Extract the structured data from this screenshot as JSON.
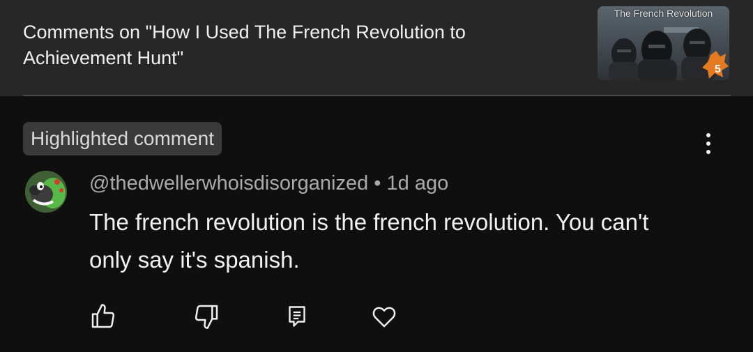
{
  "header": {
    "title": "Comments on \"How I Used The French Revolution to Achievement Hunt\"",
    "thumbnail_text": "The French Revolution",
    "thumbnail_badge": "5"
  },
  "highlight": {
    "badge_label": "Highlighted comment"
  },
  "comment": {
    "author": "@thedwellerwhoisdisorganized",
    "separator": " • ",
    "time": "1d ago",
    "text": "The french revolution is the french revolution. You can't only say it's spanish."
  },
  "actions": [
    "like-icon",
    "dislike-icon",
    "reply-icon",
    "heart-icon"
  ],
  "colors": {
    "background": "#0f0f0f",
    "header_bg": "#272727",
    "badge_bg": "#3a3a3a",
    "text_primary": "#f1f1f1",
    "text_secondary": "#aaaaaa"
  }
}
